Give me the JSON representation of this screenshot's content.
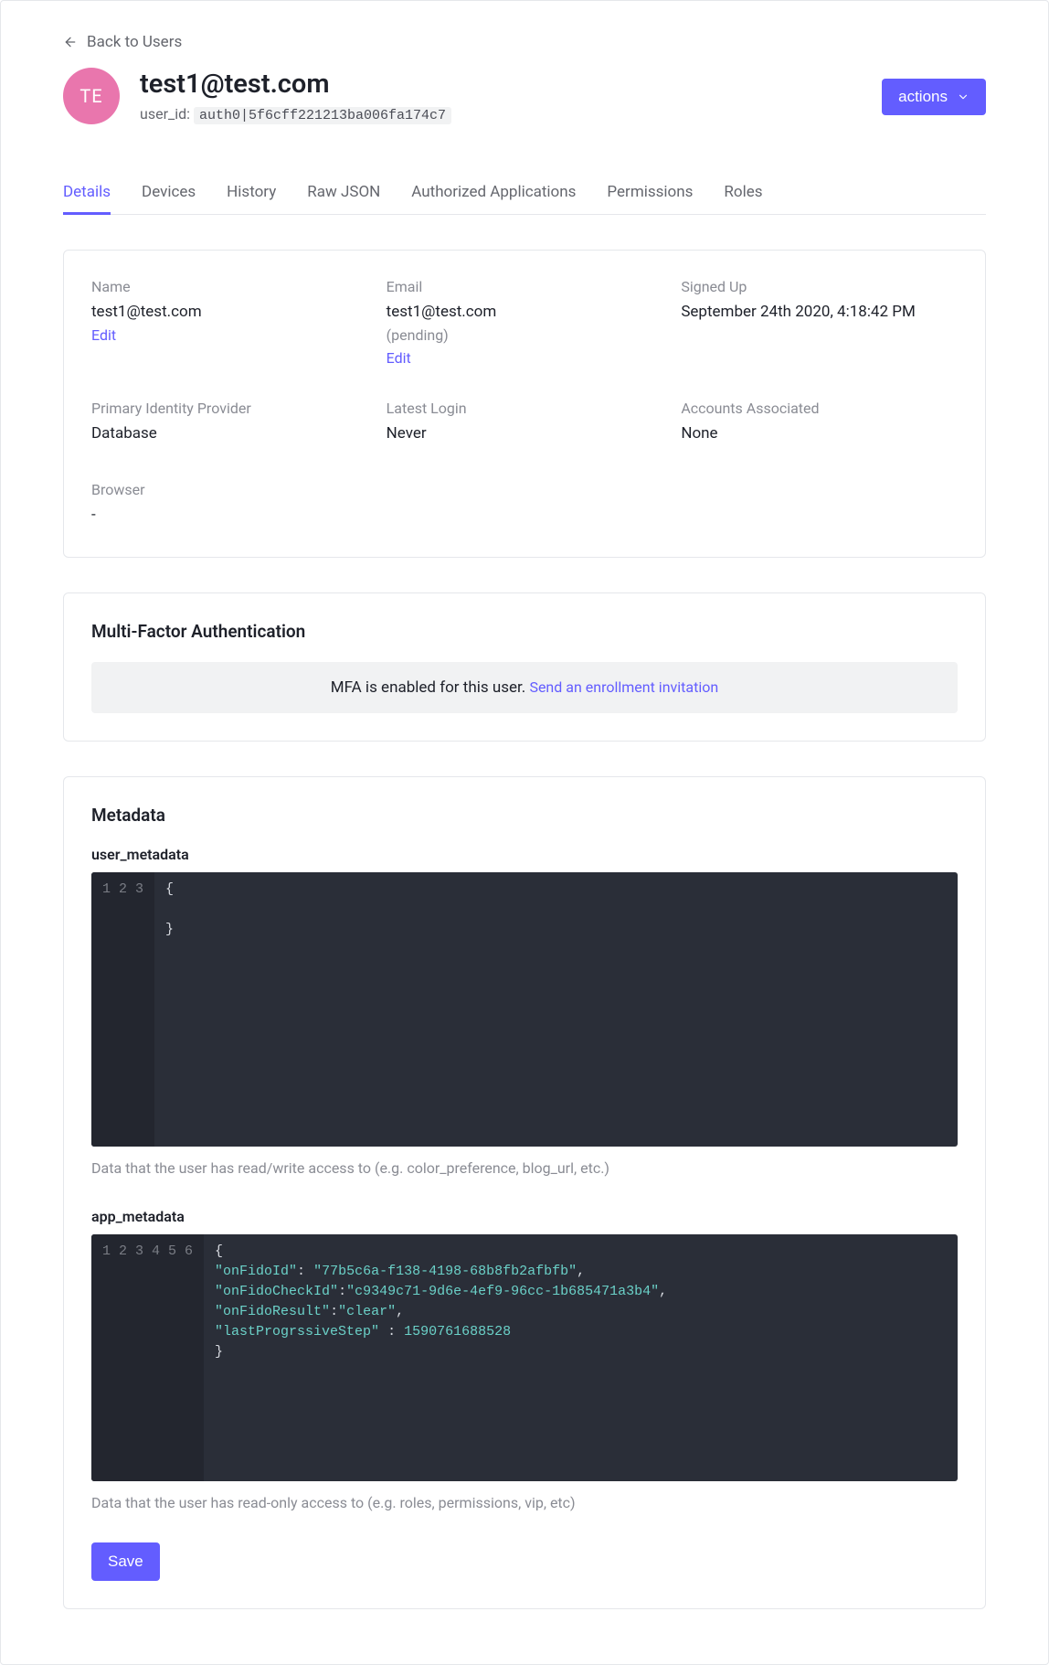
{
  "back_label": "Back to Users",
  "avatar_initials": "TE",
  "user_title": "test1@test.com",
  "user_id_label": "user_id:",
  "user_id_value": "auth0|5f6cff221213ba006fa174c7",
  "actions_label": "actions",
  "tabs": [
    "Details",
    "Devices",
    "History",
    "Raw JSON",
    "Authorized Applications",
    "Permissions",
    "Roles"
  ],
  "active_tab_index": 0,
  "info": {
    "name": {
      "label": "Name",
      "value": "test1@test.com",
      "edit": "Edit"
    },
    "email": {
      "label": "Email",
      "value": "test1@test.com",
      "note": "(pending)",
      "edit": "Edit"
    },
    "signed_up": {
      "label": "Signed Up",
      "value": "September 24th 2020, 4:18:42 PM"
    },
    "provider": {
      "label": "Primary Identity Provider",
      "value": "Database"
    },
    "latest_login": {
      "label": "Latest Login",
      "value": "Never"
    },
    "accounts": {
      "label": "Accounts Associated",
      "value": "None"
    },
    "browser": {
      "label": "Browser",
      "value": "-"
    }
  },
  "mfa": {
    "title": "Multi-Factor Authentication",
    "text": "MFA is enabled for this user. ",
    "link": "Send an enrollment invitation"
  },
  "metadata": {
    "title": "Metadata",
    "user_meta_label": "user_metadata",
    "user_meta_lines": [
      "{",
      "",
      "}"
    ],
    "user_meta_hint": "Data that the user has read/write access to (e.g. color_preference, blog_url, etc.)",
    "app_meta_label": "app_metadata",
    "app_meta": {
      "onFidoId": "77b5c6a-f138-4198-68b8fb2afbfb",
      "onFidoCheckId": "c9349c71-9d6e-4ef9-96cc-1b685471a3b4",
      "onFidoResult": "clear",
      "lastProgrssiveStep": 1590761688528
    },
    "app_meta_hint": "Data that the user has read-only access to (e.g. roles, permissions, vip, etc)",
    "save_label": "Save"
  }
}
